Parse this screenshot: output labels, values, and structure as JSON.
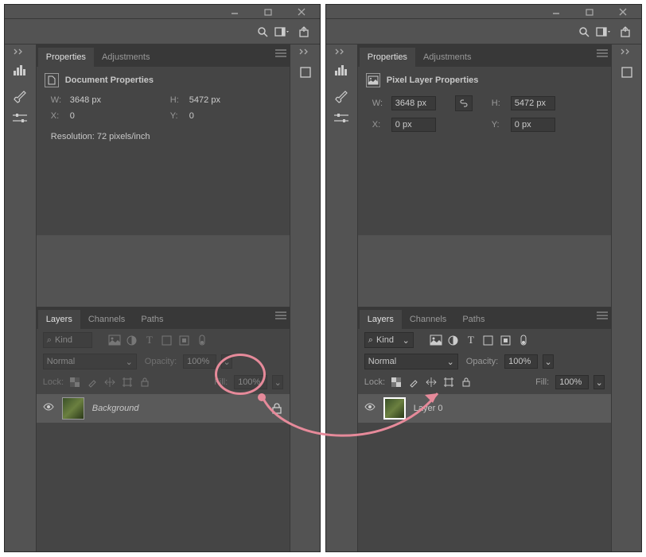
{
  "left": {
    "tabs": {
      "properties": "Properties",
      "adjustments": "Adjustments"
    },
    "props": {
      "title": "Document Properties",
      "w_lbl": "W:",
      "w": "3648 px",
      "h_lbl": "H:",
      "h": "5472 px",
      "x_lbl": "X:",
      "x": "0",
      "y_lbl": "Y:",
      "y": "0",
      "res": "Resolution: 72 pixels/inch"
    },
    "layers": {
      "tabs": {
        "layers": "Layers",
        "channels": "Channels",
        "paths": "Paths"
      },
      "kind_lbl": "Kind",
      "blend": "Normal",
      "opacity_lbl": "Opacity:",
      "opacity": "100%",
      "lock_lbl": "Lock:",
      "fill_lbl": "Fill:",
      "fill": "100%",
      "layer_name": "Background"
    }
  },
  "right": {
    "tabs": {
      "properties": "Properties",
      "adjustments": "Adjustments"
    },
    "props": {
      "title": "Pixel Layer Properties",
      "w_lbl": "W:",
      "w": "3648 px",
      "h_lbl": "H:",
      "h": "5472 px",
      "x_lbl": "X:",
      "x": "0 px",
      "y_lbl": "Y:",
      "y": "0 px"
    },
    "layers": {
      "tabs": {
        "layers": "Layers",
        "channels": "Channels",
        "paths": "Paths"
      },
      "kind_lbl": "Kind",
      "blend": "Normal",
      "opacity_lbl": "Opacity:",
      "opacity": "100%",
      "lock_lbl": "Lock:",
      "fill_lbl": "Fill:",
      "fill": "100%",
      "layer_name": "Layer 0"
    }
  },
  "glyphs": {
    "search": "⌕",
    "chevdown": "⌄"
  }
}
